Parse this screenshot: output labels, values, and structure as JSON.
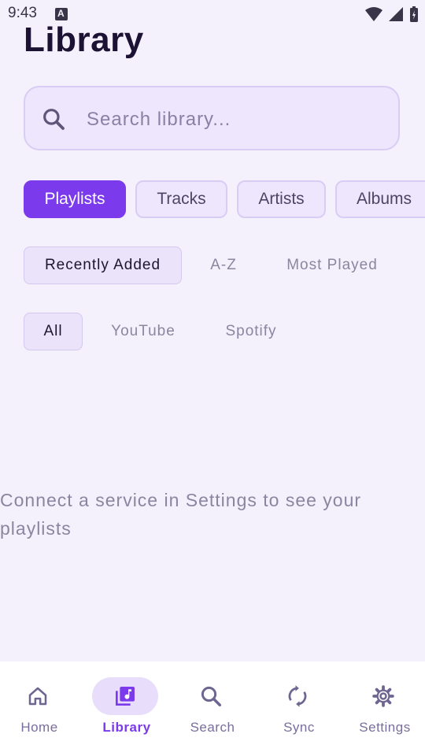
{
  "status_bar": {
    "time": "9:43"
  },
  "page": {
    "title": "Library"
  },
  "search": {
    "placeholder": "Search library..."
  },
  "tabs": [
    {
      "label": "Playlists",
      "active": true
    },
    {
      "label": "Tracks",
      "active": false
    },
    {
      "label": "Artists",
      "active": false
    },
    {
      "label": "Albums",
      "active": false
    }
  ],
  "sort_options": [
    {
      "label": "Recently Added",
      "active": true
    },
    {
      "label": "A-Z",
      "active": false
    },
    {
      "label": "Most Played",
      "active": false
    }
  ],
  "source_filters": [
    {
      "label": "All",
      "active": true
    },
    {
      "label": "YouTube",
      "active": false
    },
    {
      "label": "Spotify",
      "active": false
    }
  ],
  "empty_state": {
    "message": "Connect a service in Settings to see your playlists"
  },
  "bottom_nav": [
    {
      "label": "Home",
      "icon": "home-icon",
      "active": false
    },
    {
      "label": "Library",
      "icon": "library-music-icon",
      "active": true
    },
    {
      "label": "Search",
      "icon": "search-icon",
      "active": false
    },
    {
      "label": "Sync",
      "icon": "sync-icon",
      "active": false
    },
    {
      "label": "Settings",
      "icon": "gear-icon",
      "active": false
    }
  ],
  "colors": {
    "accent": "#7C3AED",
    "background": "#F4F1FC",
    "chip_bg": "#EDE6FD"
  }
}
